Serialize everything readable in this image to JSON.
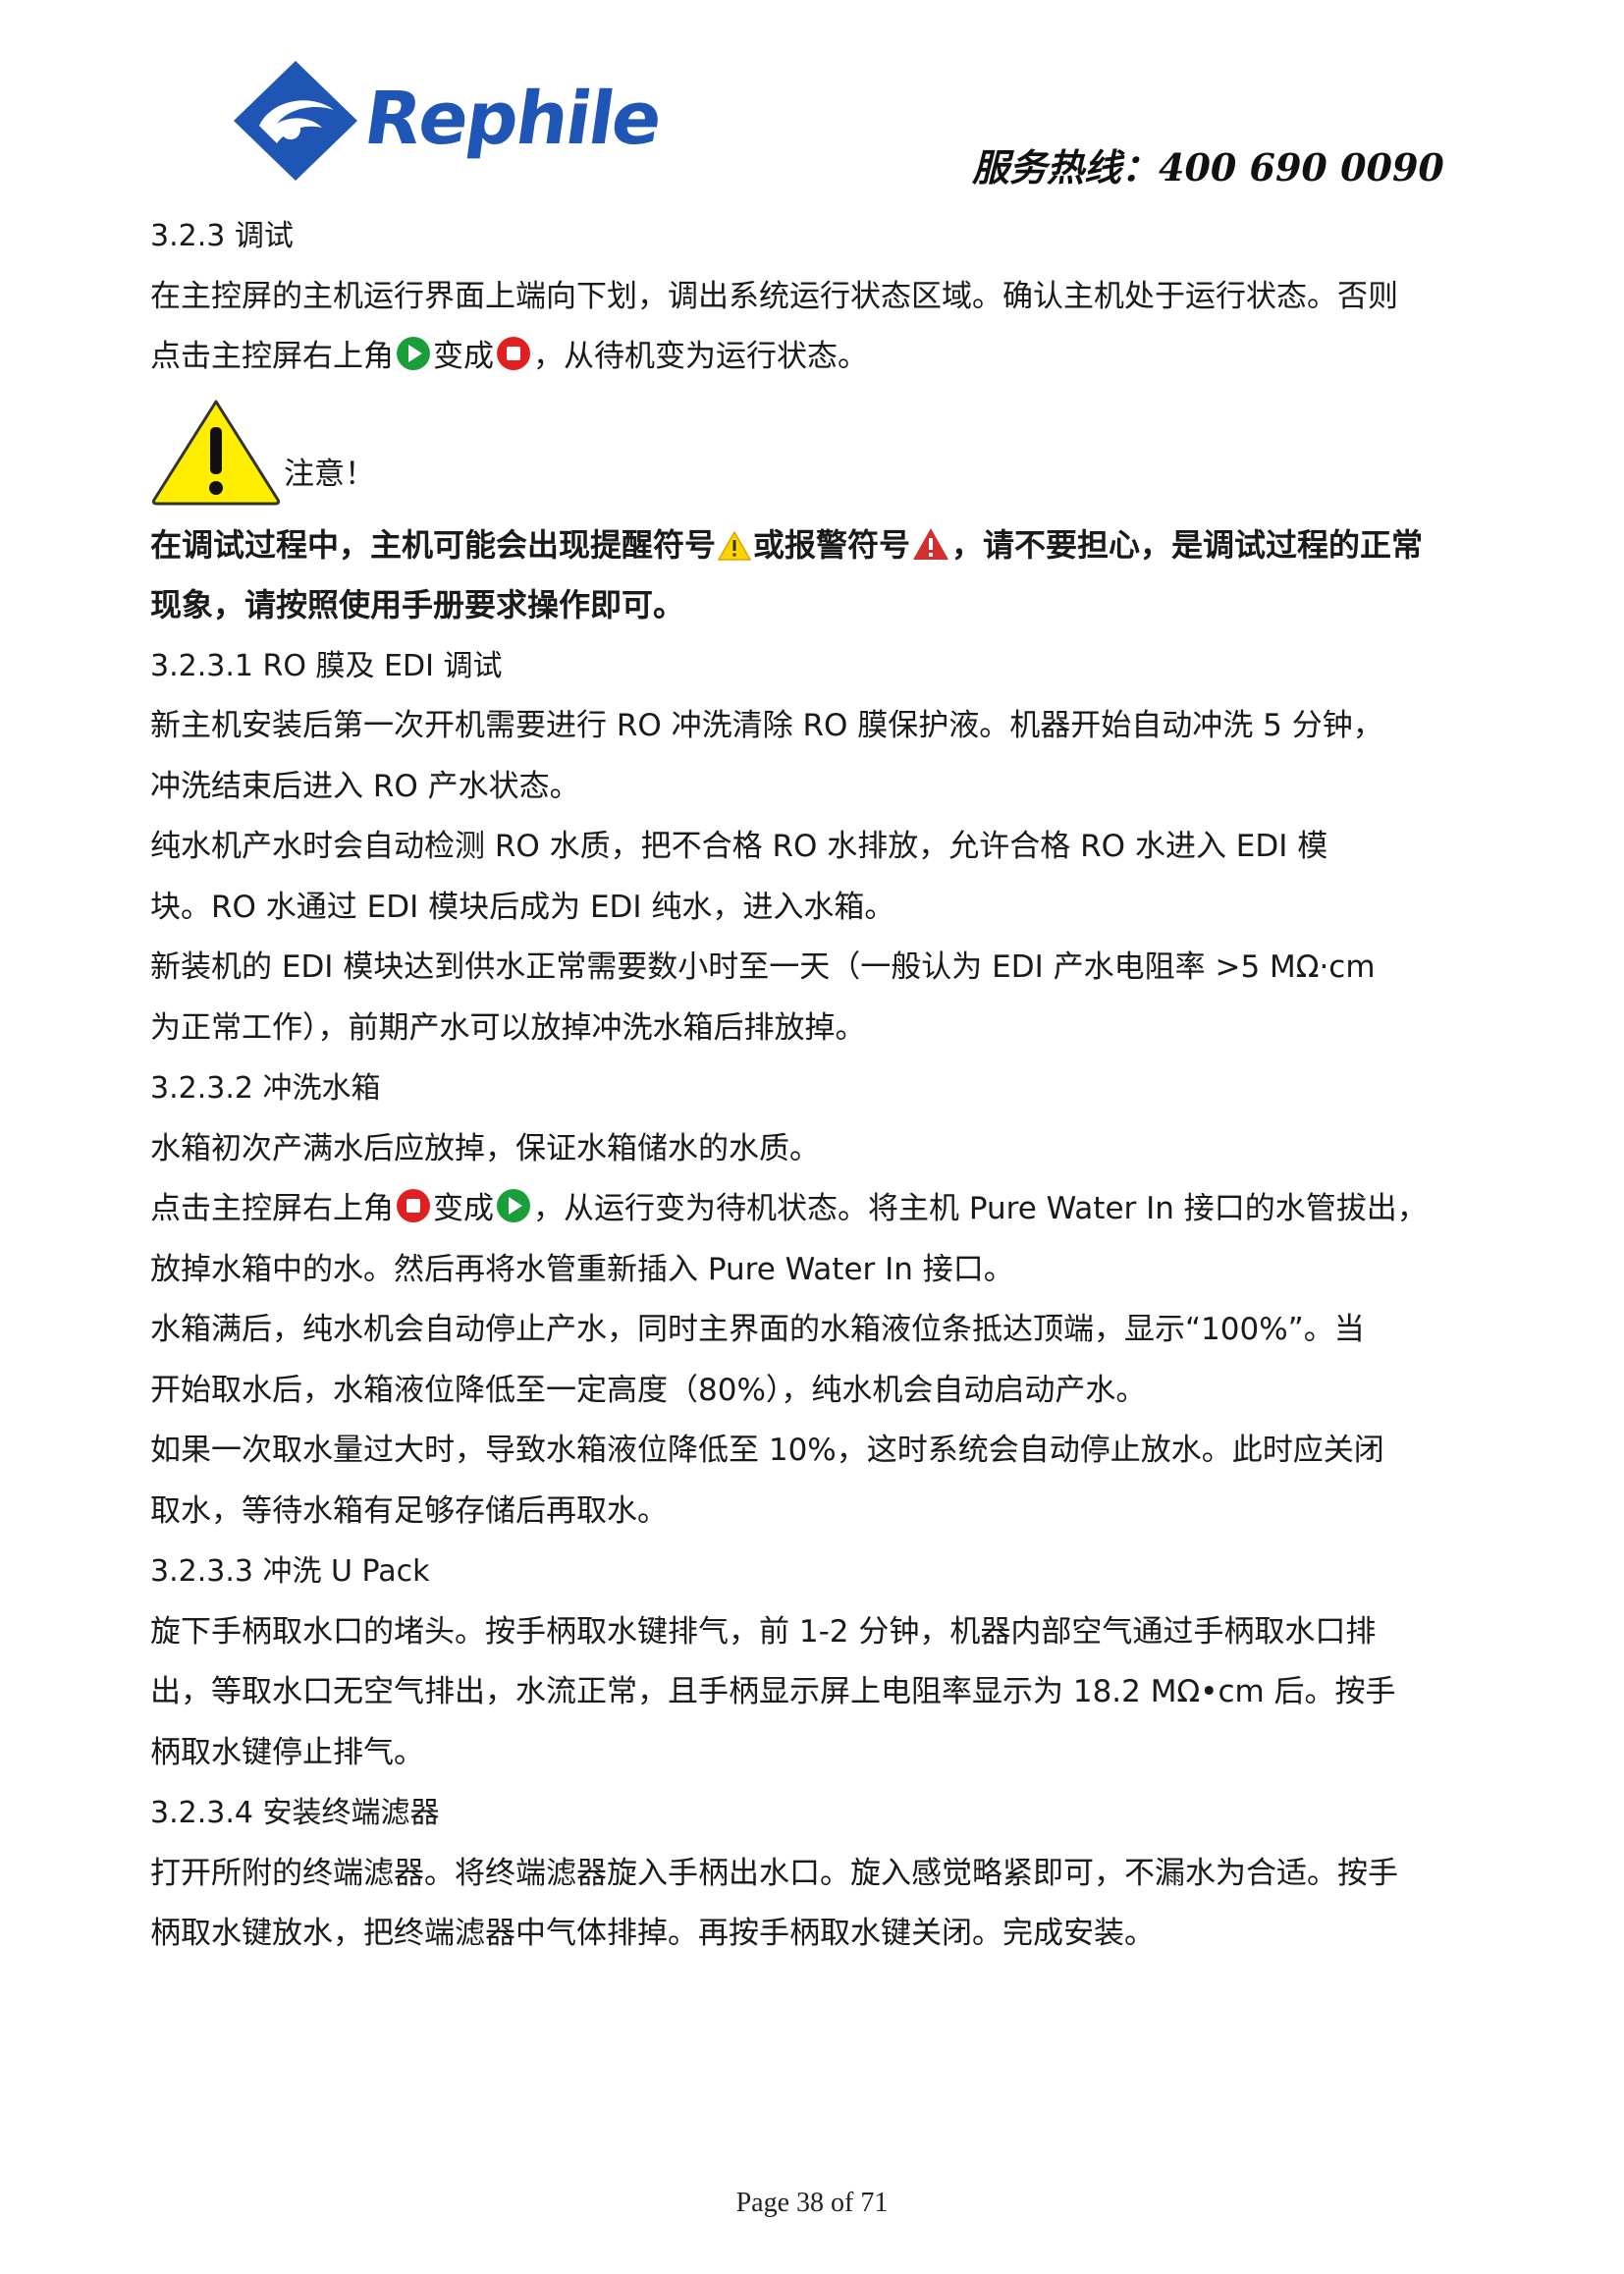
{
  "header": {
    "brand": "Rephile",
    "hotline": "服务热线：400  690  0090"
  },
  "body": {
    "s323_heading": "3.2.3 调试",
    "s323_p1_l1": "在主控屏的主机运行界面上端向下划，调出系统运行状态区域。确认主机处于运行状态。否则",
    "s323_p1_l2_a": "点击主控屏右上角",
    "s323_p1_l2_b": "变成",
    "s323_p1_l2_c": "，从待机变为运行状态。",
    "caution_label": "注意！",
    "bold_l1_a": "在调试过程中，主机可能会出现提醒符号",
    "bold_l1_b": "或报警符号",
    "bold_l1_c": "，请不要担心，是调试过程的正常",
    "bold_l2": "现象，请按照使用手册要求操作即可。",
    "s3231_heading": "3.2.3.1 RO 膜及 EDI 调试",
    "s3231_l1": "新主机安装后第一次开机需要进行 RO 冲洗清除 RO 膜保护液。机器开始自动冲洗 5 分钟，",
    "s3231_l2": "冲洗结束后进入 RO 产水状态。",
    "s3231_l3": "纯水机产水时会自动检测 RO 水质，把不合格 RO 水排放，允许合格 RO 水进入 EDI 模",
    "s3231_l4": "块。RO 水通过 EDI 模块后成为 EDI 纯水，进入水箱。",
    "s3231_l5": "新装机的 EDI 模块达到供水正常需要数小时至一天（一般认为 EDI 产水电阻率 >5 MΩ·cm",
    "s3231_l6": "为正常工作），前期产水可以放掉冲洗水箱后排放掉。",
    "s3232_heading": "3.2.3.2 冲洗水箱",
    "s3232_l1": "水箱初次产满水后应放掉，保证水箱储水的水质。",
    "s3232_l2_a": "点击主控屏右上角",
    "s3232_l2_b": "变成",
    "s3232_l2_c": "，从运行变为待机状态。将主机 Pure Water In 接口的水管拔出，",
    "s3232_l3": "放掉水箱中的水。然后再将水管重新插入 Pure Water In 接口。",
    "s3232_l4": "水箱满后，纯水机会自动停止产水，同时主界面的水箱液位条抵达顶端，显示“100%”。当",
    "s3232_l5": "开始取水后，水箱液位降低至一定高度（80%），纯水机会自动启动产水。",
    "s3232_l6": "如果一次取水量过大时，导致水箱液位降低至 10%，这时系统会自动停止放水。此时应关闭",
    "s3232_l7": "取水，等待水箱有足够存储后再取水。",
    "s3233_heading": "3.2.3.3 冲洗 U Pack",
    "s3233_l1": "旋下手柄取水口的堵头。按手柄取水键排气，前 1-2 分钟，机器内部空气通过手柄取水口排",
    "s3233_l2": "出，等取水口无空气排出，水流正常，且手柄显示屏上电阻率显示为 18.2 MΩ•cm 后。按手",
    "s3233_l3": "柄取水键停止排气。",
    "s3234_heading": "3.2.3.4 安装终端滤器",
    "s3234_l1": "打开所附的终端滤器。将终端滤器旋入手柄出水口。旋入感觉略紧即可，不漏水为合适。按手",
    "s3234_l2": "柄取水键放水，把终端滤器中气体排掉。再按手柄取水键关闭。完成安装。"
  },
  "footer": {
    "page": "Page 38 of 71"
  },
  "colors": {
    "brand_blue": "#1f55b5",
    "play_green": "#1a9e3a",
    "stop_red": "#e02020",
    "caution_yellow": "#ffee00",
    "alarm_red": "#d32f2f"
  }
}
